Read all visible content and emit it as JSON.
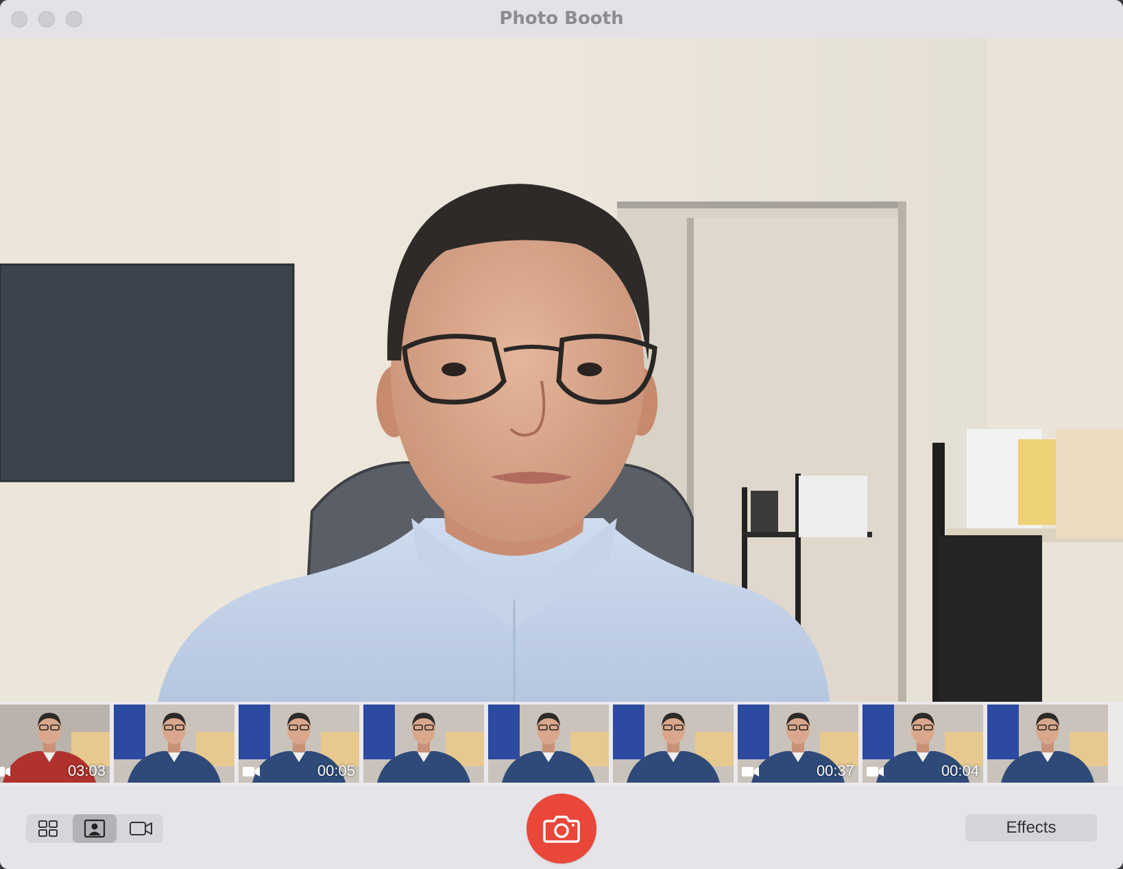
{
  "window": {
    "title": "Photo Booth"
  },
  "thumbnails": [
    {
      "kind": "video",
      "duration": "03:03",
      "shirt": "#b0322c",
      "bg": "#b9b3ac"
    },
    {
      "kind": "photo",
      "duration": "",
      "shirt": "#2f4a78",
      "bg": "#c9c3bb"
    },
    {
      "kind": "video",
      "duration": "00:05",
      "shirt": "#2f4a78",
      "bg": "#c9c3bb"
    },
    {
      "kind": "photo",
      "duration": "",
      "shirt": "#2f4a78",
      "bg": "#c9c3bb"
    },
    {
      "kind": "photo",
      "duration": "",
      "shirt": "#2f4a78",
      "bg": "#c9c3bb"
    },
    {
      "kind": "photo",
      "duration": "",
      "shirt": "#2f4a78",
      "bg": "#c9c3bb"
    },
    {
      "kind": "video",
      "duration": "00:37",
      "shirt": "#2f4a78",
      "bg": "#c9c3bb"
    },
    {
      "kind": "video",
      "duration": "00:04",
      "shirt": "#2f4a78",
      "bg": "#c9c3bb"
    },
    {
      "kind": "photo",
      "duration": "",
      "shirt": "#2f4a78",
      "bg": "#c9c3bb"
    }
  ],
  "toolbar": {
    "modes": [
      {
        "icon": "four-up-grid-icon",
        "active": false
      },
      {
        "icon": "single-photo-icon",
        "active": true
      },
      {
        "icon": "video-camera-icon",
        "active": false
      }
    ],
    "shutter_icon": "camera-icon",
    "effects_label": "Effects"
  },
  "colors": {
    "shutter": "#e8473a",
    "window_bg": "#e6e4e9"
  }
}
